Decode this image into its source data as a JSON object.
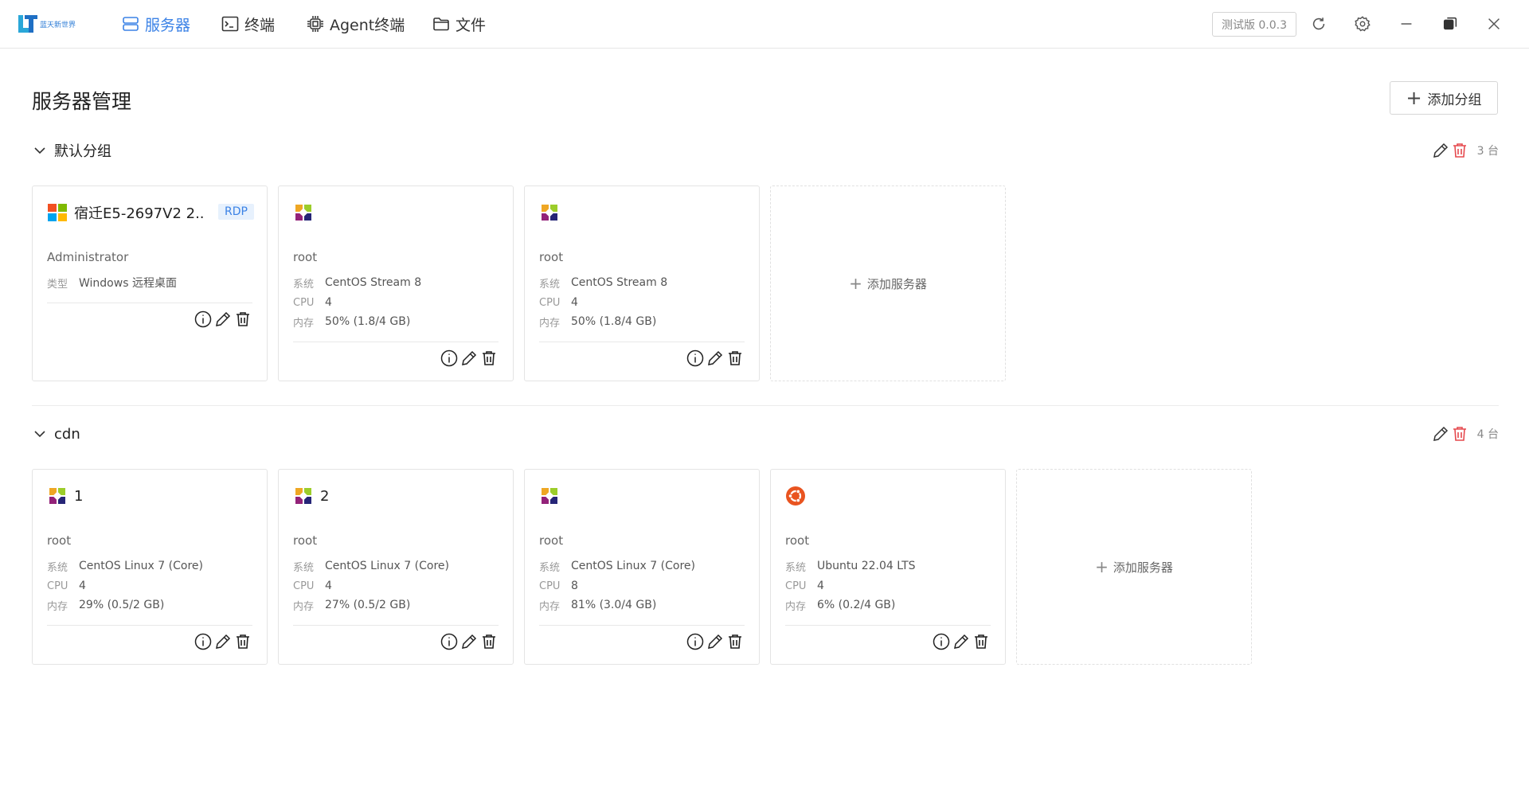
{
  "app": {
    "logo_text": "蓝天新世界",
    "nav": [
      {
        "label": "服务器",
        "icon": "server-icon",
        "active": true
      },
      {
        "label": "终端",
        "icon": "terminal-icon",
        "active": false
      },
      {
        "label": "Agent终端",
        "icon": "chip-icon",
        "active": false
      },
      {
        "label": "文件",
        "icon": "folder-icon",
        "active": false
      }
    ],
    "version": "测试版 0.0.3",
    "accent": "#3b82e6",
    "danger": "#e5484d"
  },
  "page": {
    "title": "服务器管理",
    "add_group_label": "添加分组",
    "add_server_label": "添加服务器"
  },
  "labels": {
    "type": "类型",
    "os": "系统",
    "cpu": "CPU",
    "mem": "内存"
  },
  "groups": [
    {
      "name": "默认分组",
      "count": "3 台",
      "servers": [
        {
          "name": "宿迁E5-2697V2 2...",
          "tag": "RDP",
          "logo": "windows-logo-icon",
          "user": "Administrator",
          "type": "Windows 远程桌面"
        },
        {
          "name": "",
          "logo": "centos-logo-icon",
          "user": "root",
          "os": "CentOS Stream 8",
          "cpu": "4",
          "mem": "50% (1.8/4 GB)"
        },
        {
          "name": "",
          "logo": "centos-logo-icon",
          "user": "root",
          "os": "CentOS Stream 8",
          "cpu": "4",
          "mem": "50% (1.8/4 GB)"
        }
      ]
    },
    {
      "name": "cdn",
      "count": "4 台",
      "servers": [
        {
          "name": "1",
          "logo": "centos-logo-icon",
          "user": "root",
          "os": "CentOS Linux 7 (Core)",
          "cpu": "4",
          "mem": "29% (0.5/2 GB)"
        },
        {
          "name": "2",
          "logo": "centos-logo-icon",
          "user": "root",
          "os": "CentOS Linux 7 (Core)",
          "cpu": "4",
          "mem": "27% (0.5/2 GB)"
        },
        {
          "name": "",
          "logo": "centos-logo-icon",
          "user": "root",
          "os": "CentOS Linux 7 (Core)",
          "cpu": "8",
          "mem": "81% (3.0/4 GB)"
        },
        {
          "name": "",
          "logo": "ubuntu-logo-icon",
          "user": "root",
          "os": "Ubuntu 22.04 LTS",
          "cpu": "4",
          "mem": "6% (0.2/4 GB)"
        }
      ]
    }
  ]
}
